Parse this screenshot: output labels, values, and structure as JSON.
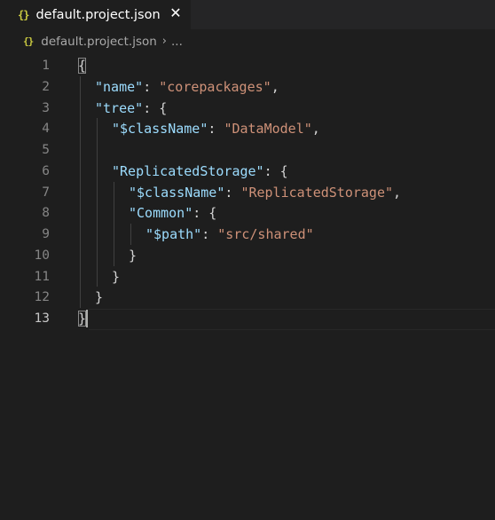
{
  "tab": {
    "icon": "json-file-icon",
    "icon_glyph": "{}",
    "filename": "default.project.json",
    "close_glyph": "✕"
  },
  "breadcrumb": {
    "icon_glyph": "{}",
    "file": "default.project.json",
    "separator": "›",
    "more": "..."
  },
  "editor": {
    "language": "json",
    "active_line": 13,
    "colors": {
      "background": "#1e1e1e",
      "key": "#9cdcfe",
      "string": "#ce9178",
      "punctuation": "#d4d4d4",
      "line_number": "#858585",
      "json_icon": "#cbcb41"
    },
    "lines": [
      {
        "n": "1",
        "indent": 0,
        "tokens": [
          {
            "t": "{",
            "c": "punc"
          }
        ]
      },
      {
        "n": "2",
        "indent": 1,
        "tokens": [
          {
            "t": "\"name\"",
            "c": "key"
          },
          {
            "t": ": ",
            "c": "punc"
          },
          {
            "t": "\"corepackages\"",
            "c": "str"
          },
          {
            "t": ",",
            "c": "punc"
          }
        ]
      },
      {
        "n": "3",
        "indent": 1,
        "tokens": [
          {
            "t": "\"tree\"",
            "c": "key"
          },
          {
            "t": ": {",
            "c": "punc"
          }
        ]
      },
      {
        "n": "4",
        "indent": 2,
        "tokens": [
          {
            "t": "\"$className\"",
            "c": "key"
          },
          {
            "t": ": ",
            "c": "punc"
          },
          {
            "t": "\"DataModel\"",
            "c": "str"
          },
          {
            "t": ",",
            "c": "punc"
          }
        ]
      },
      {
        "n": "5",
        "indent": 2,
        "tokens": []
      },
      {
        "n": "6",
        "indent": 2,
        "tokens": [
          {
            "t": "\"ReplicatedStorage\"",
            "c": "key"
          },
          {
            "t": ": {",
            "c": "punc"
          }
        ]
      },
      {
        "n": "7",
        "indent": 3,
        "tokens": [
          {
            "t": "\"$className\"",
            "c": "key"
          },
          {
            "t": ": ",
            "c": "punc"
          },
          {
            "t": "\"ReplicatedStorage\"",
            "c": "str"
          },
          {
            "t": ",",
            "c": "punc"
          }
        ]
      },
      {
        "n": "8",
        "indent": 3,
        "tokens": [
          {
            "t": "\"Common\"",
            "c": "key"
          },
          {
            "t": ": {",
            "c": "punc"
          }
        ]
      },
      {
        "n": "9",
        "indent": 4,
        "tokens": [
          {
            "t": "\"$path\"",
            "c": "key"
          },
          {
            "t": ": ",
            "c": "punc"
          },
          {
            "t": "\"src/shared\"",
            "c": "str"
          }
        ]
      },
      {
        "n": "10",
        "indent": 3,
        "tokens": [
          {
            "t": "}",
            "c": "punc"
          }
        ]
      },
      {
        "n": "11",
        "indent": 2,
        "tokens": [
          {
            "t": "}",
            "c": "punc"
          }
        ]
      },
      {
        "n": "12",
        "indent": 1,
        "tokens": [
          {
            "t": "}",
            "c": "punc"
          }
        ]
      },
      {
        "n": "13",
        "indent": 0,
        "tokens": [
          {
            "t": "}",
            "c": "punc"
          }
        ]
      }
    ]
  }
}
